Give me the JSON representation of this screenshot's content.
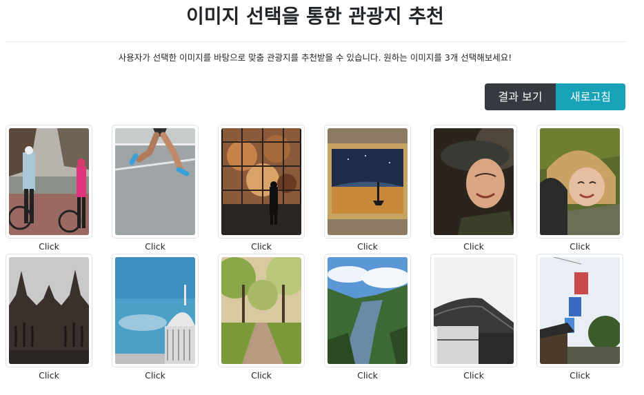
{
  "page": {
    "title": "이미지 선택을 통한 관광지 추천",
    "subtitle": "사용자가 선택한 이미지를 바탕으로 맞춤 관광지를 추천받을 수 있습니다. 원하는 이미지를 3개 선택해보세요!"
  },
  "buttons": {
    "result_label": "결과 보기",
    "refresh_label": "새로고침"
  },
  "colors": {
    "result_button": "#343a40",
    "refresh_button": "#17a2b8"
  },
  "images": [
    {
      "caption": "Click",
      "subject": "cyclists-photo"
    },
    {
      "caption": "Click",
      "subject": "runner-photo"
    },
    {
      "caption": "Click",
      "subject": "gallery-visitor-photo"
    },
    {
      "caption": "Click",
      "subject": "framed-painting-photo"
    },
    {
      "caption": "Click",
      "subject": "smiling-woman-photo"
    },
    {
      "caption": "Click",
      "subject": "woman-with-dog-photo"
    },
    {
      "caption": "Click",
      "subject": "gothic-cathedral-photo"
    },
    {
      "caption": "Click",
      "subject": "dome-building-photo"
    },
    {
      "caption": "Click",
      "subject": "park-path-photo"
    },
    {
      "caption": "Click",
      "subject": "river-valley-photo"
    },
    {
      "caption": "Click",
      "subject": "traditional-roof-photo"
    },
    {
      "caption": "Click",
      "subject": "lanterns-photo"
    }
  ]
}
